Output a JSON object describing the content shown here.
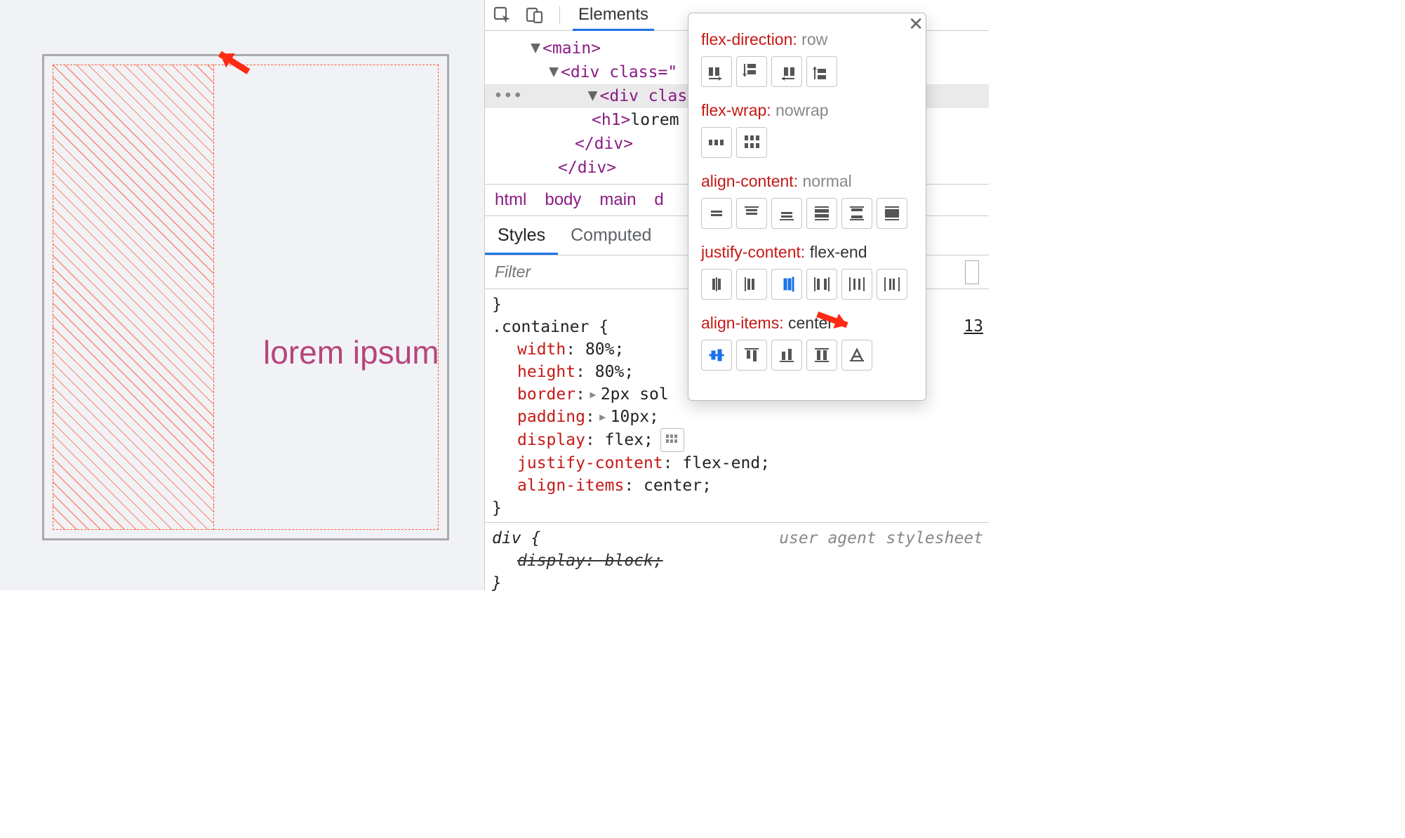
{
  "preview": {
    "text": "lorem ipsum"
  },
  "devtools": {
    "top_tab_active": "Elements",
    "tree": {
      "main_tag": "<main>",
      "div1": "<div class=\"",
      "div2": "<div class=",
      "h1": "lorem",
      "h1_open": "<h1>",
      "close_div1": "</div>",
      "close_div2": "</div>"
    },
    "breadcrumb": [
      "html",
      "body",
      "main",
      "d"
    ],
    "styles_tabs": {
      "styles": "Styles",
      "computed": "Computed"
    },
    "filter_placeholder": "Filter",
    "link_line": "13",
    "rule": {
      "selector": ".container {",
      "props": [
        {
          "k": "width",
          "v": "80%;"
        },
        {
          "k": "height",
          "v": "80%;"
        },
        {
          "k": "border",
          "v": "2px sol",
          "tri": true
        },
        {
          "k": "padding",
          "v": "10px;",
          "tri": true
        },
        {
          "k": "display",
          "v": "flex;",
          "badge": true
        },
        {
          "k": "justify-content",
          "v": "flex-end;"
        },
        {
          "k": "align-items",
          "v": "center;"
        }
      ],
      "close": "}"
    },
    "ua": {
      "selector": "div {",
      "prop": "display: block;",
      "close": "}",
      "label": "user agent stylesheet"
    }
  },
  "popover": {
    "groups": [
      {
        "prop": "flex-direction",
        "val": "row",
        "dim": true,
        "icons": [
          "fd-row",
          "fd-col",
          "fd-row-rev",
          "fd-col-rev"
        ],
        "selected": -1
      },
      {
        "prop": "flex-wrap",
        "val": "nowrap",
        "dim": true,
        "icons": [
          "fw-nowrap",
          "fw-wrap"
        ],
        "selected": -1
      },
      {
        "prop": "align-content",
        "val": "normal",
        "dim": true,
        "icons": [
          "ac-1",
          "ac-2",
          "ac-3",
          "ac-4",
          "ac-5",
          "ac-6"
        ],
        "selected": -1
      },
      {
        "prop": "justify-content",
        "val": "flex-end",
        "dim": false,
        "icons": [
          "jc-center",
          "jc-start",
          "jc-end",
          "jc-between",
          "jc-around",
          "jc-evenly"
        ],
        "selected": 2
      },
      {
        "prop": "align-items",
        "val": "center",
        "dim": false,
        "icons": [
          "ai-center",
          "ai-start",
          "ai-end",
          "ai-stretch",
          "ai-baseline"
        ],
        "selected": 0
      }
    ]
  }
}
